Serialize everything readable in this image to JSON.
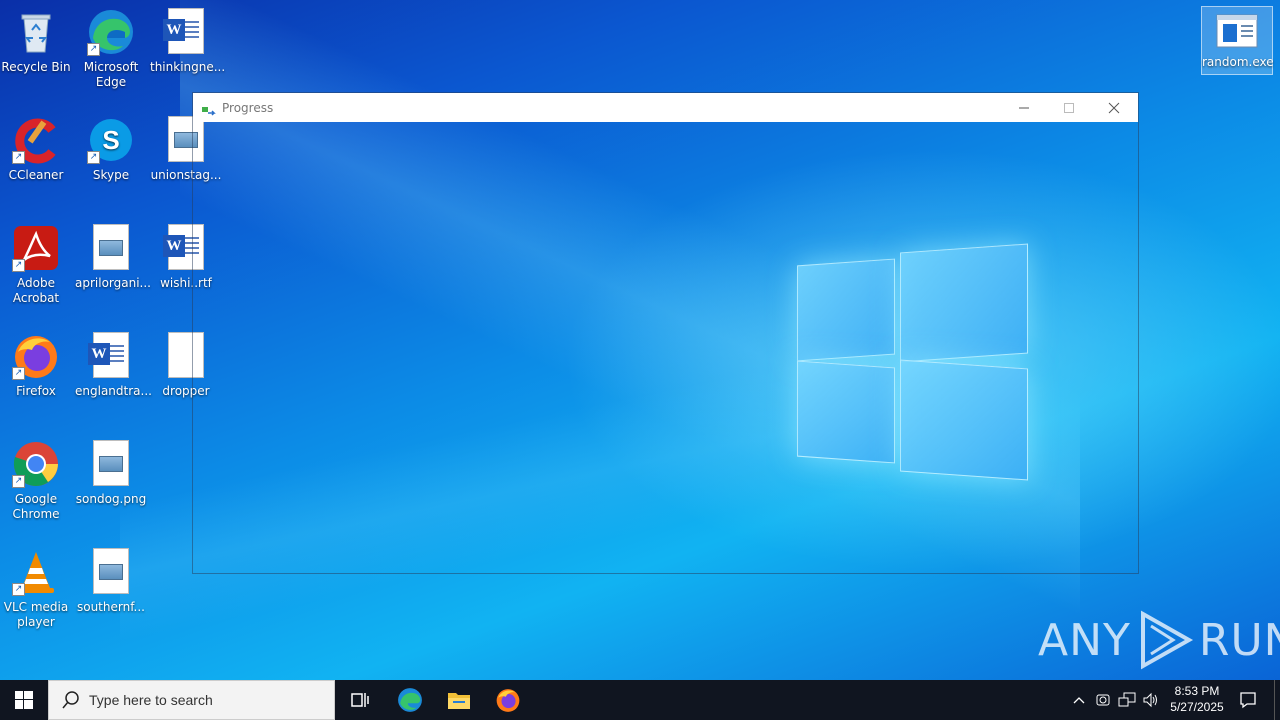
{
  "desktop_icons": {
    "recycle_bin": "Recycle Bin",
    "edge": "Microsoft Edge",
    "thinking": "thinkingne...",
    "ccleaner": "CCleaner",
    "skype": "Skype",
    "unionstag": "unionstag...",
    "acrobat": "Adobe Acrobat",
    "aprilorgani": "aprilorgani...",
    "wishi": "wishi..rtf",
    "firefox": "Firefox",
    "englandtra": "englandtra...",
    "dropper": "dropper",
    "chrome": "Google Chrome",
    "sondog": "sondog.png",
    "vlc": "VLC media player",
    "southernf": "southernf...",
    "random_exe": "random.exe"
  },
  "window": {
    "title": "Progress"
  },
  "taskbar": {
    "search_placeholder": "Type here to search",
    "time": "8:53 PM",
    "date": "5/27/2025"
  },
  "watermark": {
    "left": "ANY",
    "right": "RUN"
  },
  "colors": {
    "taskbar": "#101520",
    "accent": "#0b78e3"
  }
}
